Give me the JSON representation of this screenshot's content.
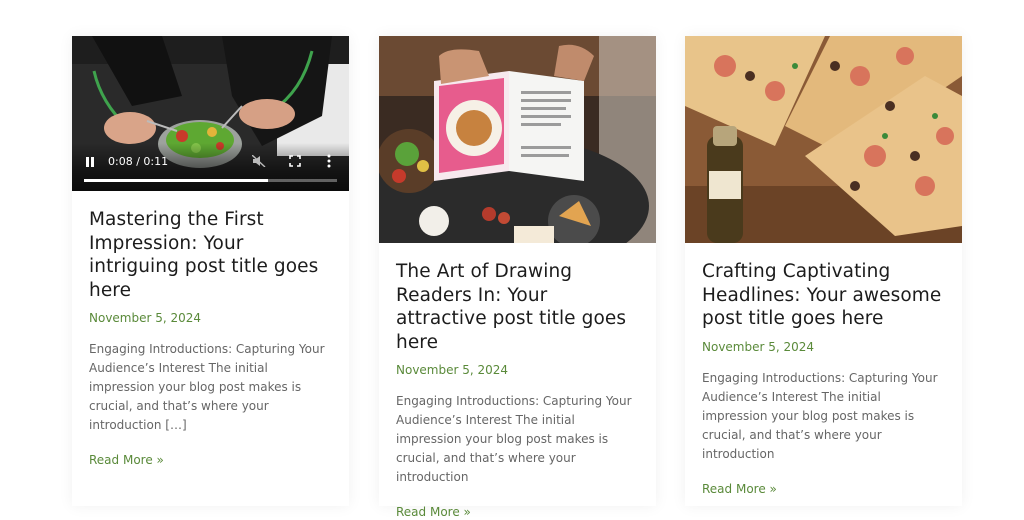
{
  "posts": [
    {
      "title": "Mastering the First Impression: Your intriguing post title goes here",
      "date": "November 5, 2024",
      "excerpt": "Engaging Introductions: Capturing Your Audience’s Interest The initial impression your blog post makes is crucial, and that’s where your introduction […]",
      "read_more": "Read More »",
      "media": "video",
      "video": {
        "time": "0:08 / 0:11",
        "progress": 0.727
      }
    },
    {
      "title": "The Art of Drawing Readers In: Your attractive post title goes here",
      "date": "November 5, 2024",
      "excerpt": "Engaging Introductions: Capturing Your Audience’s Interest The initial impression your blog post makes is crucial, and that’s where your introduction",
      "read_more": "Read More »",
      "media": "image"
    },
    {
      "title": "Crafting Captivating Headlines: Your awesome post title goes here",
      "date": "November 5, 2024",
      "excerpt": "Engaging Introductions: Capturing Your Audience’s Interest The initial impression your blog post makes is crucial, and that’s where your introduction",
      "read_more": "Read More »",
      "media": "image"
    }
  ],
  "colors": {
    "accent": "#5a8a3a",
    "title": "#1c1c1c",
    "body_text": "#666666"
  }
}
